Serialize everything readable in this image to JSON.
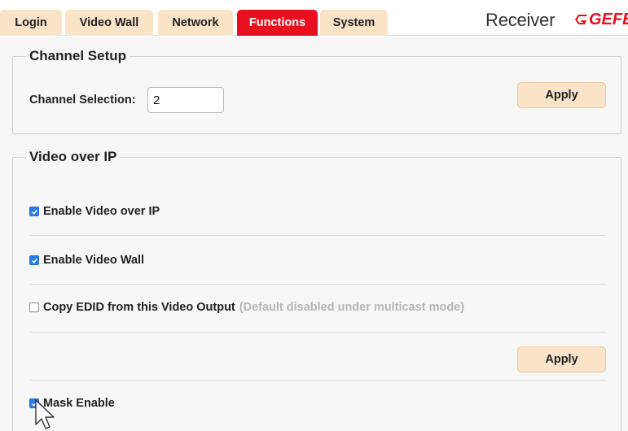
{
  "tabs": [
    {
      "label": "Login",
      "active": false
    },
    {
      "label": "Video Wall",
      "active": false
    },
    {
      "label": "Network",
      "active": false
    },
    {
      "label": "Functions",
      "active": true
    },
    {
      "label": "System",
      "active": false
    }
  ],
  "header": {
    "device_label": "Receiver",
    "brand_text": "GEFEN",
    "brand_color": "#e8101e"
  },
  "channel_setup": {
    "legend": "Channel Setup",
    "channel_label": "Channel Selection:",
    "channel_value": "2",
    "apply_label": "Apply"
  },
  "video_over_ip": {
    "legend": "Video over IP",
    "enable_video_over_ip": {
      "label": "Enable Video over IP",
      "checked": true
    },
    "enable_video_wall": {
      "label": "Enable Video Wall",
      "checked": true
    },
    "copy_edid": {
      "label": "Copy EDID from this Video Output",
      "hint": "(Default disabled under multicast mode)",
      "checked": false
    },
    "apply_label": "Apply",
    "mask_enable": {
      "label": "Mask Enable",
      "checked": true
    }
  },
  "colors": {
    "tab_active": "#e8101e",
    "tab_inactive": "#fbe3c8",
    "checkbox_checked": "#2a7fe6"
  },
  "icons": {
    "checkmark": "check-icon",
    "pointer": "mouse-cursor-icon"
  }
}
